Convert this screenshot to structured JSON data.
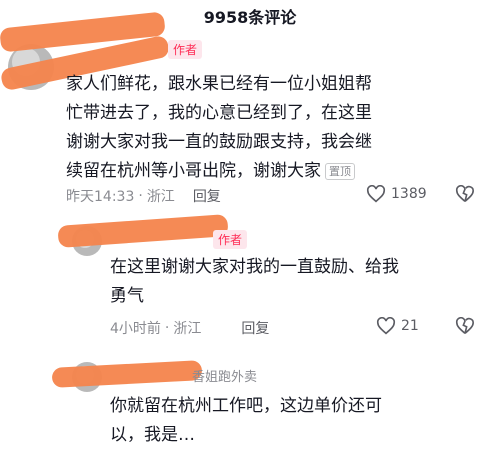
{
  "header": {
    "title": "9958条评论"
  },
  "comments": [
    {
      "tag": "作者",
      "text_lines": [
        "家人们鲜花，跟水果已经有一位小姐姐帮",
        "忙带进去了，我的心意已经到了，在这里",
        "谢谢大家对我一直的鼓励跟支持，我会继",
        "续留在杭州等小哥出院，谢谢大家"
      ],
      "pinned_label": "置顶",
      "time": "昨天14:33",
      "location": "浙江",
      "reply_label": "回复",
      "likes": "1389"
    },
    {
      "tag": "作者",
      "text_lines": [
        "在这里谢谢大家对我的一直鼓励、给我",
        "勇气"
      ],
      "time": "4小时前",
      "location": "浙江",
      "reply_label": "回复",
      "likes": "21"
    },
    {
      "nickname": "香姐跑外卖",
      "text_lines": [
        "你就留在杭州工作吧，这边单价还可",
        "以，我是…"
      ]
    }
  ],
  "colors": {
    "accent": "#fe2c55",
    "redaction": "#f4844c",
    "meta": "#8a8b91"
  }
}
